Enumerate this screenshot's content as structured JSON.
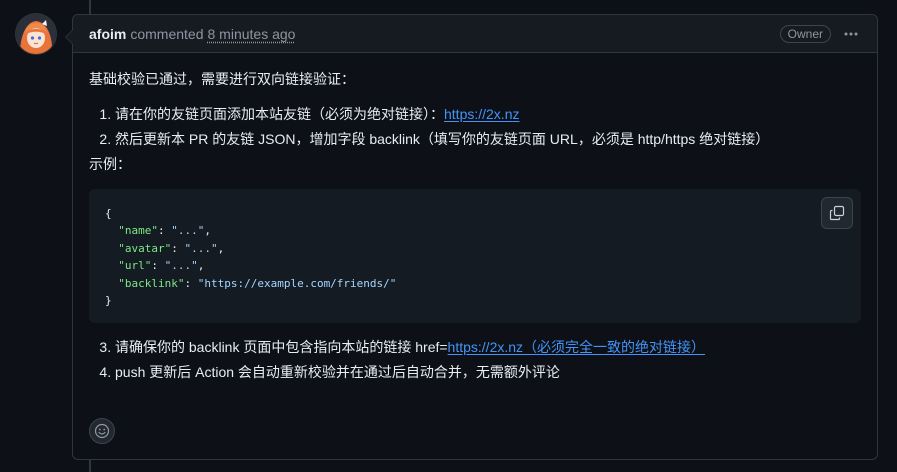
{
  "comment": {
    "author": "afoim",
    "action": "commented",
    "time": "8 minutes ago",
    "badge": "Owner",
    "intro": "基础校验已通过，需要进行双向链接验证：",
    "list1": [
      {
        "text": "请在你的友链页面添加本站友链（必须为绝对链接）：",
        "link": "https://2x.nz"
      },
      {
        "text": "然后更新本 PR 的友链 JSON，增加字段 backlink（填写你的友链页面 URL，必须是 http/https 绝对链接）"
      }
    ],
    "example_label": "示例：",
    "code": {
      "open": "{",
      "lines": [
        {
          "key": "\"name\"",
          "sep": ": ",
          "val": "\"...\"",
          "end": ","
        },
        {
          "key": "\"avatar\"",
          "sep": ": ",
          "val": "\"...\"",
          "end": ","
        },
        {
          "key": "\"url\"",
          "sep": ": ",
          "val": "\"...\"",
          "end": ","
        },
        {
          "key": "\"backlink\"",
          "sep": ": ",
          "val": "\"https://example.com/friends/\"",
          "end": ""
        }
      ],
      "close": "}"
    },
    "list2": [
      {
        "text": "请确保你的 backlink 页面中包含指向本站的链接 href=",
        "link": "https://2x.nz（必须完全一致的绝对链接）"
      },
      {
        "text": "push 更新后 Action 会自动重新校验并在通过后自动合并，无需额外评论"
      }
    ]
  },
  "icons": {
    "kebab": "kebab-horizontal-icon",
    "copy": "copy-icon",
    "emoji": "smiley-icon"
  },
  "colors": {
    "background": "#0d1117",
    "header": "#161b22",
    "border": "#30363d",
    "link": "#4493f8",
    "code_key": "#7ee787",
    "code_string": "#a5d6ff"
  }
}
